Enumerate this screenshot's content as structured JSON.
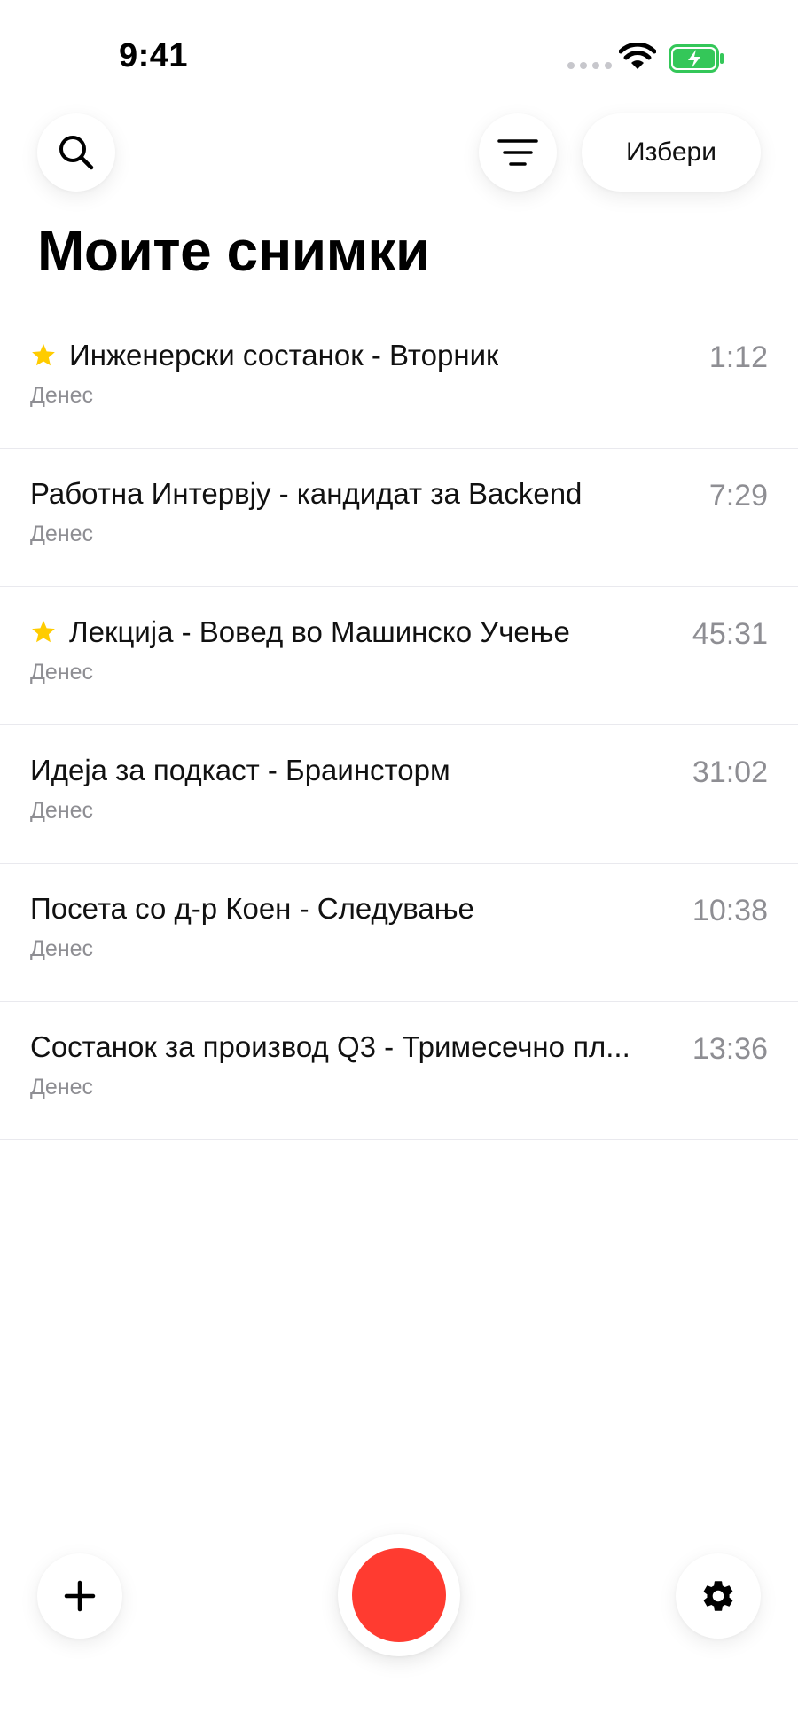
{
  "status_bar": {
    "time": "9:41",
    "icons": [
      "cellular-dots-icon",
      "wifi-icon",
      "battery-charging-icon"
    ],
    "battery_color": "#34c759"
  },
  "header": {
    "search_icon": "search-icon",
    "filter_icon": "filter-lines-icon",
    "select_label": "Избери",
    "title": "Моите снимки"
  },
  "recordings": [
    {
      "title": "Инженерски состанок - Вторник",
      "date": "Денес",
      "duration": "1:12",
      "starred": true
    },
    {
      "title": "Работна Интервју - кандидат за Backend",
      "date": "Денес",
      "duration": "7:29",
      "starred": false
    },
    {
      "title": "Лекција - Вовед во Машинско Учење",
      "date": "Денес",
      "duration": "45:31",
      "starred": true
    },
    {
      "title": "Идеја за подкаст - Браинсторм",
      "date": "Денес",
      "duration": "31:02",
      "starred": false
    },
    {
      "title": "Посета со д-р Коен - Следување",
      "date": "Денес",
      "duration": "10:38",
      "starred": false
    },
    {
      "title": "Состанок за производ Q3 - Тримесечно пл...",
      "date": "Денес",
      "duration": "13:36",
      "starred": false
    }
  ],
  "colors": {
    "record": "#ff3b30",
    "star": "#ffcc00",
    "secondary_text": "#8e8e93"
  },
  "bottom_bar": {
    "add_icon": "plus-icon",
    "record_icon": "record-icon",
    "settings_icon": "gear-icon"
  }
}
